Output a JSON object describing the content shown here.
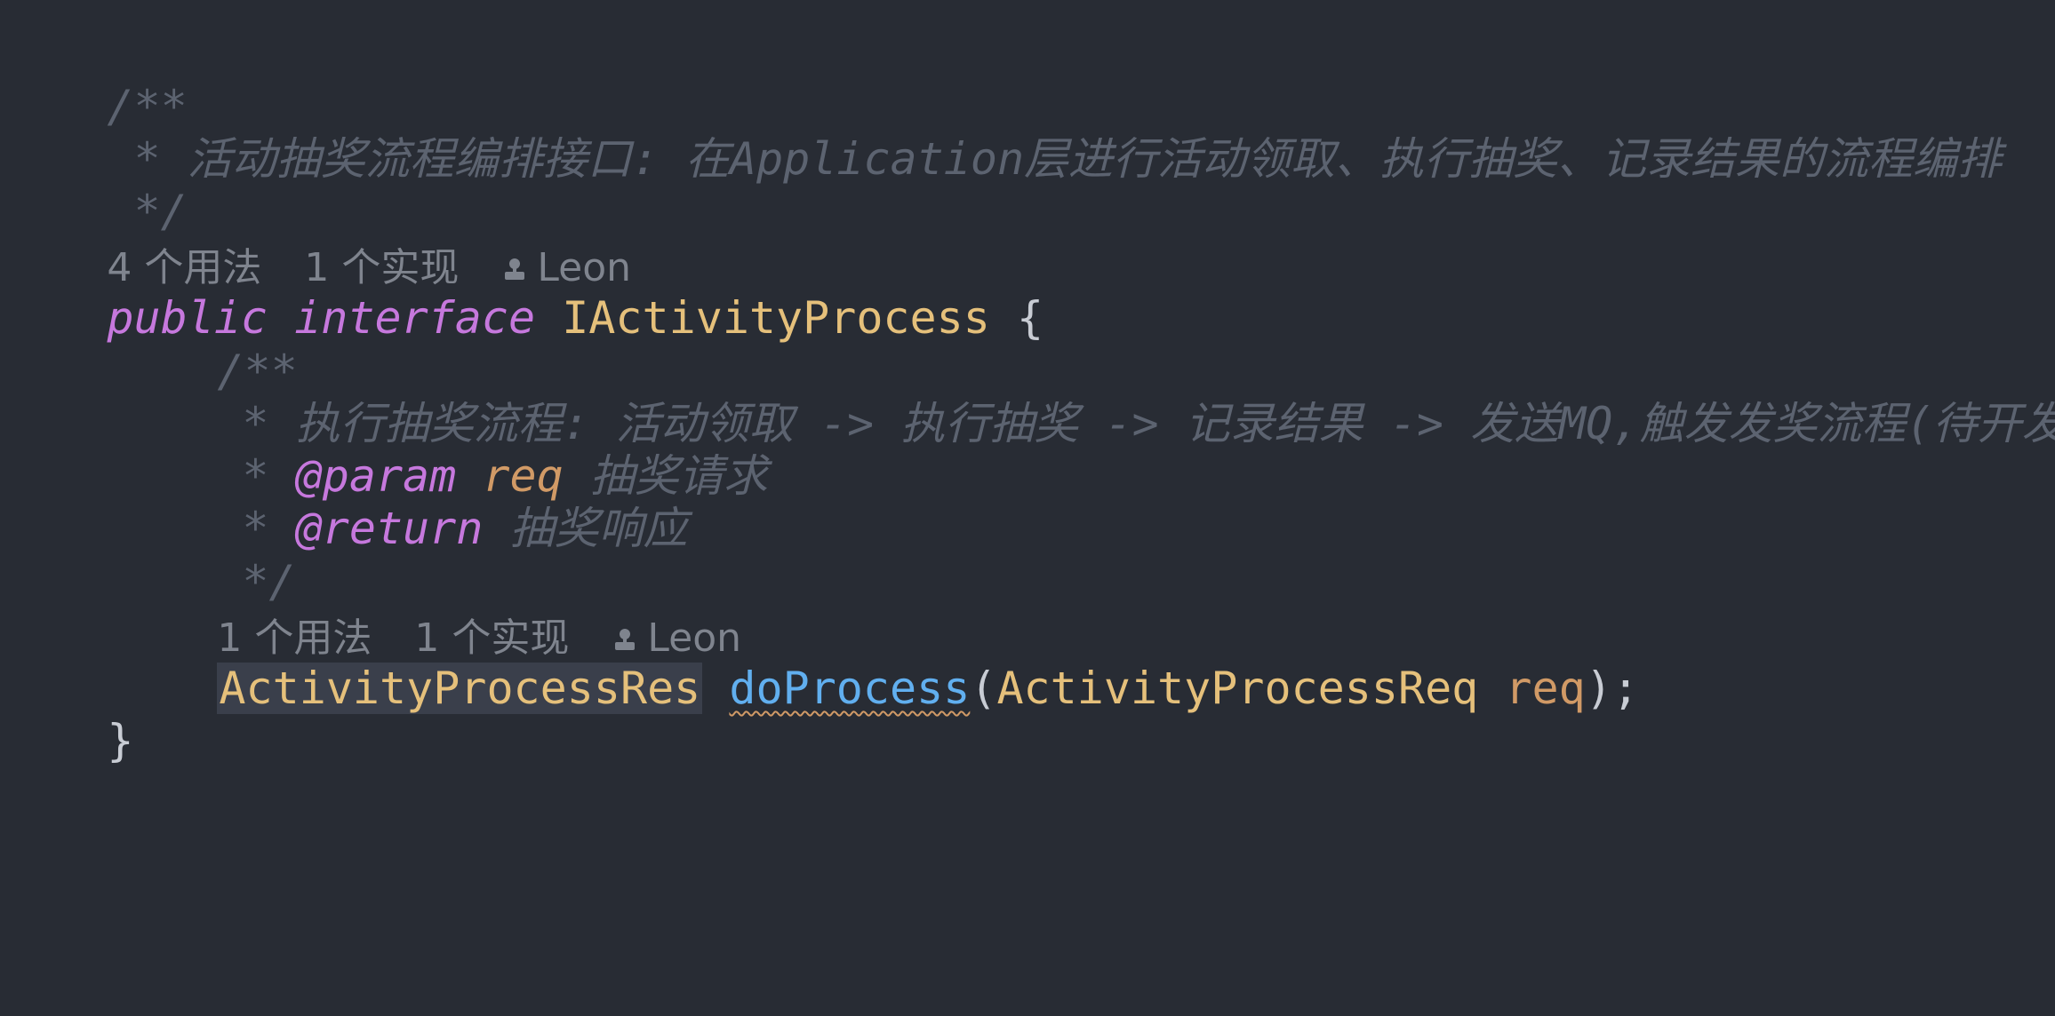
{
  "comment1": {
    "open": "/**",
    "desc": " * 活动抽奖流程编排接口: 在Application层进行活动领取、执行抽奖、记录结果的流程编排",
    "close": " */"
  },
  "hints1": {
    "usages": "4 个用法",
    "impls": "1 个实现",
    "author": "Leon"
  },
  "decl": {
    "kw_public": "public",
    "kw_interface": "interface",
    "name": "IActivityProcess",
    "brace_open": "{"
  },
  "comment2": {
    "open": "/**",
    "desc": "* 执行抽奖流程: 活动领取 -> 执行抽奖 -> 记录结果 -> 发送MQ,触发发奖流程(待开发)",
    "param_star": "* ",
    "param_tag": "@param",
    "param_name": "req",
    "param_desc": "抽奖请求",
    "return_star": "* ",
    "return_tag": "@return",
    "return_desc": "抽奖响应",
    "close": "*/"
  },
  "hints2": {
    "usages": "1 个用法",
    "impls": "1 个实现",
    "author": "Leon"
  },
  "method": {
    "return_type": "ActivityProcessRes",
    "name": "doProcess",
    "paren_open": "(",
    "param_type": "ActivityProcessReq",
    "param_name": "req",
    "paren_close": ");"
  },
  "brace_close": "}",
  "colors": {
    "background": "#282c34",
    "keyword": "#c678dd",
    "type": "#e5c07b",
    "function": "#61afef",
    "parameter": "#d19a66",
    "comment": "#5c6370",
    "hint": "#7f848e"
  },
  "icons": {
    "author": "person-icon"
  }
}
